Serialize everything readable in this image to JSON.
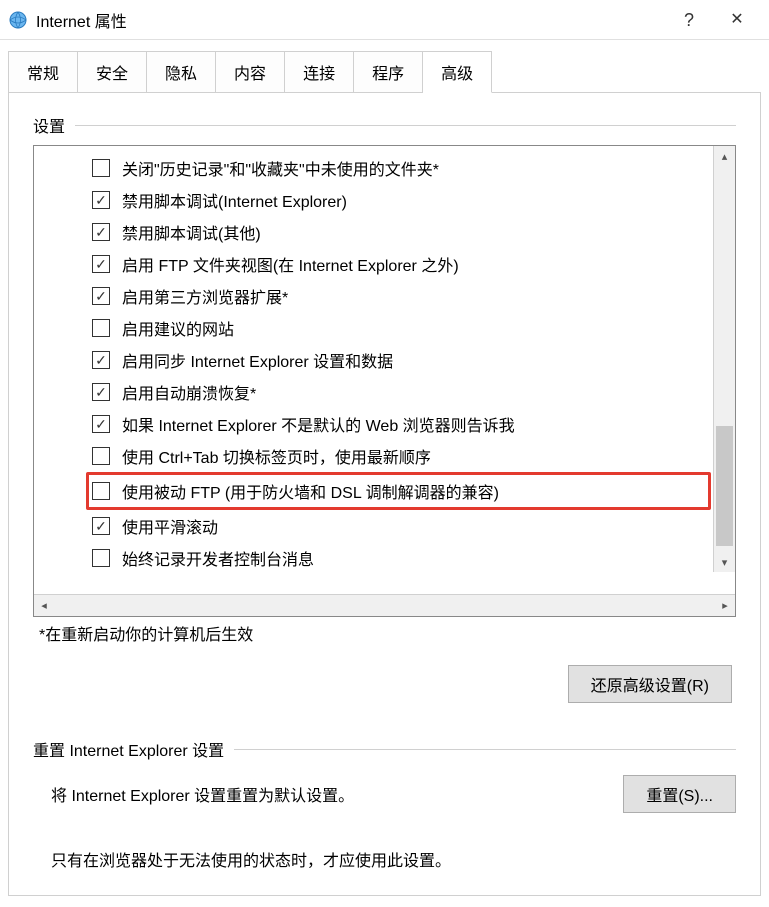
{
  "window": {
    "title": "Internet 属性",
    "help": "?",
    "close": "✕"
  },
  "tabs": {
    "items": [
      {
        "label": "常规"
      },
      {
        "label": "安全"
      },
      {
        "label": "隐私"
      },
      {
        "label": "内容"
      },
      {
        "label": "连接"
      },
      {
        "label": "程序"
      },
      {
        "label": "高级",
        "active": true
      }
    ]
  },
  "settings": {
    "group_title": "设置",
    "note": "*在重新启动你的计算机后生效",
    "restore_button": "还原高级设置(R)",
    "items": [
      {
        "checked": false,
        "label": "关闭\"历史记录\"和\"收藏夹\"中未使用的文件夹*"
      },
      {
        "checked": true,
        "label": "禁用脚本调试(Internet Explorer)"
      },
      {
        "checked": true,
        "label": "禁用脚本调试(其他)"
      },
      {
        "checked": true,
        "label": "启用 FTP 文件夹视图(在 Internet Explorer 之外)"
      },
      {
        "checked": true,
        "label": "启用第三方浏览器扩展*"
      },
      {
        "checked": false,
        "label": "启用建议的网站"
      },
      {
        "checked": true,
        "label": "启用同步 Internet Explorer 设置和数据"
      },
      {
        "checked": true,
        "label": "启用自动崩溃恢复*"
      },
      {
        "checked": true,
        "label": "如果 Internet Explorer 不是默认的 Web 浏览器则告诉我"
      },
      {
        "checked": false,
        "label": "使用 Ctrl+Tab 切换标签页时，使用最新顺序"
      },
      {
        "checked": false,
        "label": "使用被动 FTP (用于防火墙和 DSL 调制解调器的兼容)",
        "highlight": true
      },
      {
        "checked": true,
        "label": "使用平滑滚动"
      },
      {
        "checked": false,
        "label": "始终记录开发者控制台消息"
      }
    ]
  },
  "reset": {
    "group_title": "重置 Internet Explorer 设置",
    "desc": "将 Internet Explorer 设置重置为默认设置。",
    "button": "重置(S)...",
    "note": "只有在浏览器处于无法使用的状态时，才应使用此设置。"
  }
}
